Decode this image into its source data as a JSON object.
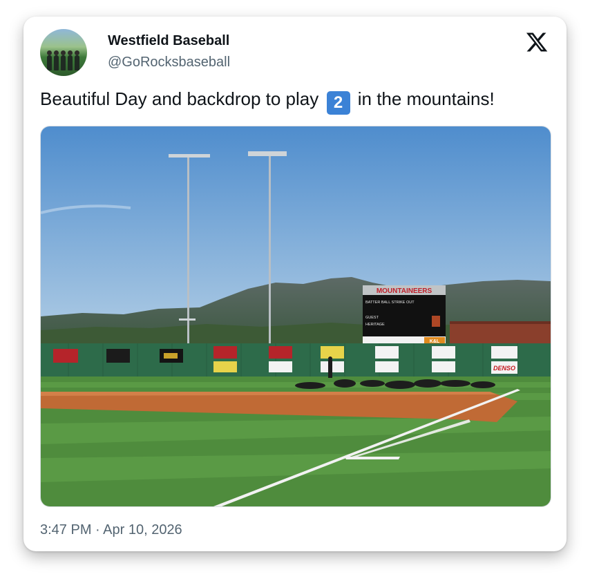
{
  "tweet": {
    "display_name": "Westfield Baseball",
    "handle": "@GoRocksbaseball",
    "text_before": "Beautiful Day and backdrop to play",
    "badge": "2",
    "text_after": "in the mountains!",
    "timestamp": "3:47 PM · Apr 10, 2026"
  },
  "photo": {
    "scoreboard_title": "MOUNTAINEERS",
    "scoreboard_row1": "BATTER  BALL  STRIKE  OUT",
    "scoreboard_guest": "GUEST",
    "scoreboard_home": "HERITAGE",
    "ads": [
      "DENSO",
      "K&L"
    ]
  },
  "colors": {
    "accent_badge": "#3b82d6",
    "text_primary": "#0f1419",
    "text_secondary": "#536471",
    "sky": "#5b95cf",
    "wall": "#2d6b4a",
    "grass": "#4f8c3d",
    "infield_dirt": "#c06a35"
  },
  "icons": {
    "platform": "x-logo-icon"
  }
}
